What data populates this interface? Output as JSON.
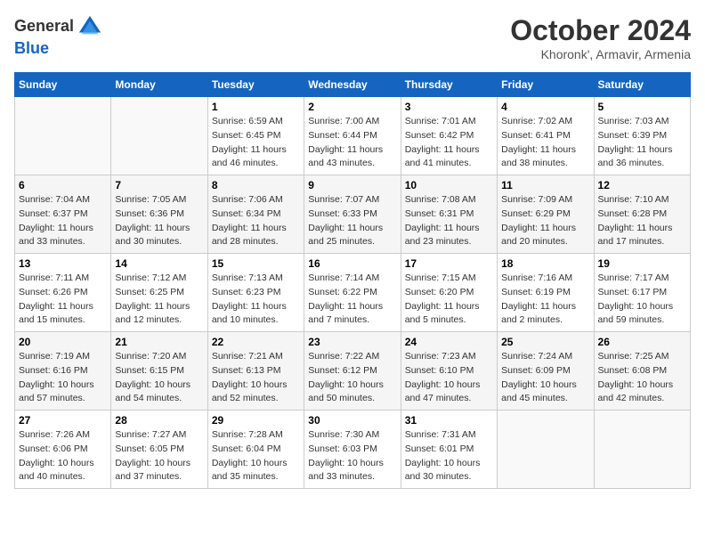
{
  "header": {
    "logo_general": "General",
    "logo_blue": "Blue",
    "month": "October 2024",
    "location": "Khoronk', Armavir, Armenia"
  },
  "calendar": {
    "days_of_week": [
      "Sunday",
      "Monday",
      "Tuesday",
      "Wednesday",
      "Thursday",
      "Friday",
      "Saturday"
    ],
    "weeks": [
      [
        {
          "day": "",
          "sunrise": "",
          "sunset": "",
          "daylight": ""
        },
        {
          "day": "",
          "sunrise": "",
          "sunset": "",
          "daylight": ""
        },
        {
          "day": "1",
          "sunrise": "Sunrise: 6:59 AM",
          "sunset": "Sunset: 6:45 PM",
          "daylight": "Daylight: 11 hours and 46 minutes."
        },
        {
          "day": "2",
          "sunrise": "Sunrise: 7:00 AM",
          "sunset": "Sunset: 6:44 PM",
          "daylight": "Daylight: 11 hours and 43 minutes."
        },
        {
          "day": "3",
          "sunrise": "Sunrise: 7:01 AM",
          "sunset": "Sunset: 6:42 PM",
          "daylight": "Daylight: 11 hours and 41 minutes."
        },
        {
          "day": "4",
          "sunrise": "Sunrise: 7:02 AM",
          "sunset": "Sunset: 6:41 PM",
          "daylight": "Daylight: 11 hours and 38 minutes."
        },
        {
          "day": "5",
          "sunrise": "Sunrise: 7:03 AM",
          "sunset": "Sunset: 6:39 PM",
          "daylight": "Daylight: 11 hours and 36 minutes."
        }
      ],
      [
        {
          "day": "6",
          "sunrise": "Sunrise: 7:04 AM",
          "sunset": "Sunset: 6:37 PM",
          "daylight": "Daylight: 11 hours and 33 minutes."
        },
        {
          "day": "7",
          "sunrise": "Sunrise: 7:05 AM",
          "sunset": "Sunset: 6:36 PM",
          "daylight": "Daylight: 11 hours and 30 minutes."
        },
        {
          "day": "8",
          "sunrise": "Sunrise: 7:06 AM",
          "sunset": "Sunset: 6:34 PM",
          "daylight": "Daylight: 11 hours and 28 minutes."
        },
        {
          "day": "9",
          "sunrise": "Sunrise: 7:07 AM",
          "sunset": "Sunset: 6:33 PM",
          "daylight": "Daylight: 11 hours and 25 minutes."
        },
        {
          "day": "10",
          "sunrise": "Sunrise: 7:08 AM",
          "sunset": "Sunset: 6:31 PM",
          "daylight": "Daylight: 11 hours and 23 minutes."
        },
        {
          "day": "11",
          "sunrise": "Sunrise: 7:09 AM",
          "sunset": "Sunset: 6:29 PM",
          "daylight": "Daylight: 11 hours and 20 minutes."
        },
        {
          "day": "12",
          "sunrise": "Sunrise: 7:10 AM",
          "sunset": "Sunset: 6:28 PM",
          "daylight": "Daylight: 11 hours and 17 minutes."
        }
      ],
      [
        {
          "day": "13",
          "sunrise": "Sunrise: 7:11 AM",
          "sunset": "Sunset: 6:26 PM",
          "daylight": "Daylight: 11 hours and 15 minutes."
        },
        {
          "day": "14",
          "sunrise": "Sunrise: 7:12 AM",
          "sunset": "Sunset: 6:25 PM",
          "daylight": "Daylight: 11 hours and 12 minutes."
        },
        {
          "day": "15",
          "sunrise": "Sunrise: 7:13 AM",
          "sunset": "Sunset: 6:23 PM",
          "daylight": "Daylight: 11 hours and 10 minutes."
        },
        {
          "day": "16",
          "sunrise": "Sunrise: 7:14 AM",
          "sunset": "Sunset: 6:22 PM",
          "daylight": "Daylight: 11 hours and 7 minutes."
        },
        {
          "day": "17",
          "sunrise": "Sunrise: 7:15 AM",
          "sunset": "Sunset: 6:20 PM",
          "daylight": "Daylight: 11 hours and 5 minutes."
        },
        {
          "day": "18",
          "sunrise": "Sunrise: 7:16 AM",
          "sunset": "Sunset: 6:19 PM",
          "daylight": "Daylight: 11 hours and 2 minutes."
        },
        {
          "day": "19",
          "sunrise": "Sunrise: 7:17 AM",
          "sunset": "Sunset: 6:17 PM",
          "daylight": "Daylight: 10 hours and 59 minutes."
        }
      ],
      [
        {
          "day": "20",
          "sunrise": "Sunrise: 7:19 AM",
          "sunset": "Sunset: 6:16 PM",
          "daylight": "Daylight: 10 hours and 57 minutes."
        },
        {
          "day": "21",
          "sunrise": "Sunrise: 7:20 AM",
          "sunset": "Sunset: 6:15 PM",
          "daylight": "Daylight: 10 hours and 54 minutes."
        },
        {
          "day": "22",
          "sunrise": "Sunrise: 7:21 AM",
          "sunset": "Sunset: 6:13 PM",
          "daylight": "Daylight: 10 hours and 52 minutes."
        },
        {
          "day": "23",
          "sunrise": "Sunrise: 7:22 AM",
          "sunset": "Sunset: 6:12 PM",
          "daylight": "Daylight: 10 hours and 50 minutes."
        },
        {
          "day": "24",
          "sunrise": "Sunrise: 7:23 AM",
          "sunset": "Sunset: 6:10 PM",
          "daylight": "Daylight: 10 hours and 47 minutes."
        },
        {
          "day": "25",
          "sunrise": "Sunrise: 7:24 AM",
          "sunset": "Sunset: 6:09 PM",
          "daylight": "Daylight: 10 hours and 45 minutes."
        },
        {
          "day": "26",
          "sunrise": "Sunrise: 7:25 AM",
          "sunset": "Sunset: 6:08 PM",
          "daylight": "Daylight: 10 hours and 42 minutes."
        }
      ],
      [
        {
          "day": "27",
          "sunrise": "Sunrise: 7:26 AM",
          "sunset": "Sunset: 6:06 PM",
          "daylight": "Daylight: 10 hours and 40 minutes."
        },
        {
          "day": "28",
          "sunrise": "Sunrise: 7:27 AM",
          "sunset": "Sunset: 6:05 PM",
          "daylight": "Daylight: 10 hours and 37 minutes."
        },
        {
          "day": "29",
          "sunrise": "Sunrise: 7:28 AM",
          "sunset": "Sunset: 6:04 PM",
          "daylight": "Daylight: 10 hours and 35 minutes."
        },
        {
          "day": "30",
          "sunrise": "Sunrise: 7:30 AM",
          "sunset": "Sunset: 6:03 PM",
          "daylight": "Daylight: 10 hours and 33 minutes."
        },
        {
          "day": "31",
          "sunrise": "Sunrise: 7:31 AM",
          "sunset": "Sunset: 6:01 PM",
          "daylight": "Daylight: 10 hours and 30 minutes."
        },
        {
          "day": "",
          "sunrise": "",
          "sunset": "",
          "daylight": ""
        },
        {
          "day": "",
          "sunrise": "",
          "sunset": "",
          "daylight": ""
        }
      ]
    ]
  }
}
